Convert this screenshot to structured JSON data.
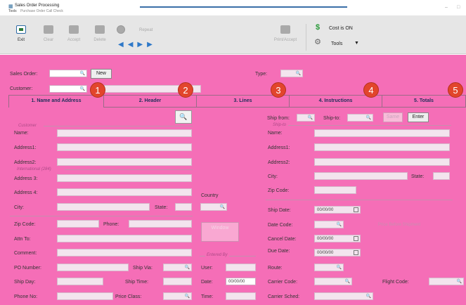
{
  "window": {
    "title": "Sales Order Processing",
    "menu": [
      "Tools",
      "Purchase Order Call Check"
    ]
  },
  "toolbar": {
    "exit": "Exit",
    "clear": "Clear",
    "accept": "Accept",
    "delete": "Delete",
    "repeat": "Repeat",
    "print_accept": "Print/Accept",
    "cost": "Cost is ON",
    "tools": "Tools"
  },
  "header": {
    "sales_order_label": "Sales Order:",
    "new_button": "New",
    "customer_label": "Customer:",
    "type_label": "Type:"
  },
  "tabs": [
    {
      "label": "1. Name and Address",
      "badge": "1"
    },
    {
      "label": "2. Header",
      "badge": "2"
    },
    {
      "label": "3. Lines",
      "badge": "3"
    },
    {
      "label": "4. Instructions",
      "badge": "4"
    },
    {
      "label": "5. Totals",
      "badge": "5"
    }
  ],
  "ship_bar": {
    "ship_from": "Ship from:",
    "ship_to": "Ship-to:",
    "same_button": "Same",
    "enter_button": "Enter"
  },
  "customer": {
    "section": "Customer",
    "name": "Name:",
    "address1": "Address1:",
    "address2": "Address2:",
    "international": "International (284)",
    "address3": "Address 3:",
    "address4": "Address 4:",
    "city": "City:",
    "state": "State:",
    "zip": "Zip Code:",
    "phone": "Phone:",
    "attn": "Attn To:",
    "comment": "Comment:",
    "po_number": "PO Number:",
    "ship_via": "Ship Via:",
    "ship_day": "Ship Day:",
    "ship_time": "Ship Time:",
    "phone_no": "Phone No:",
    "price_class": "Price Class:"
  },
  "middle": {
    "country": "Country",
    "window_button": "Window",
    "entered_by": "Entered By",
    "user": "User:",
    "date": "Date:",
    "date_value": "00/00/00",
    "time": "Time:"
  },
  "shipto": {
    "section": "Ship-to",
    "name": "Name:",
    "address1": "Address1:",
    "address2": "Address2:",
    "city": "City:",
    "state": "State:",
    "zip": "Zip Code:",
    "ship_date": "Ship Date:",
    "ship_date_value": "00/00/00",
    "date_code": "Date Code:",
    "price_before": "Price Before Shipment",
    "cancel_date": "Cancel Date:",
    "cancel_date_value": "00/00/00",
    "due_date": "Due Date:",
    "due_date_value": "00/00/00",
    "route": "Route:",
    "carrier_code": "Carrier Code:",
    "flight_code": "Flight Code:",
    "carrier_sched": "Carrier Sched:"
  }
}
